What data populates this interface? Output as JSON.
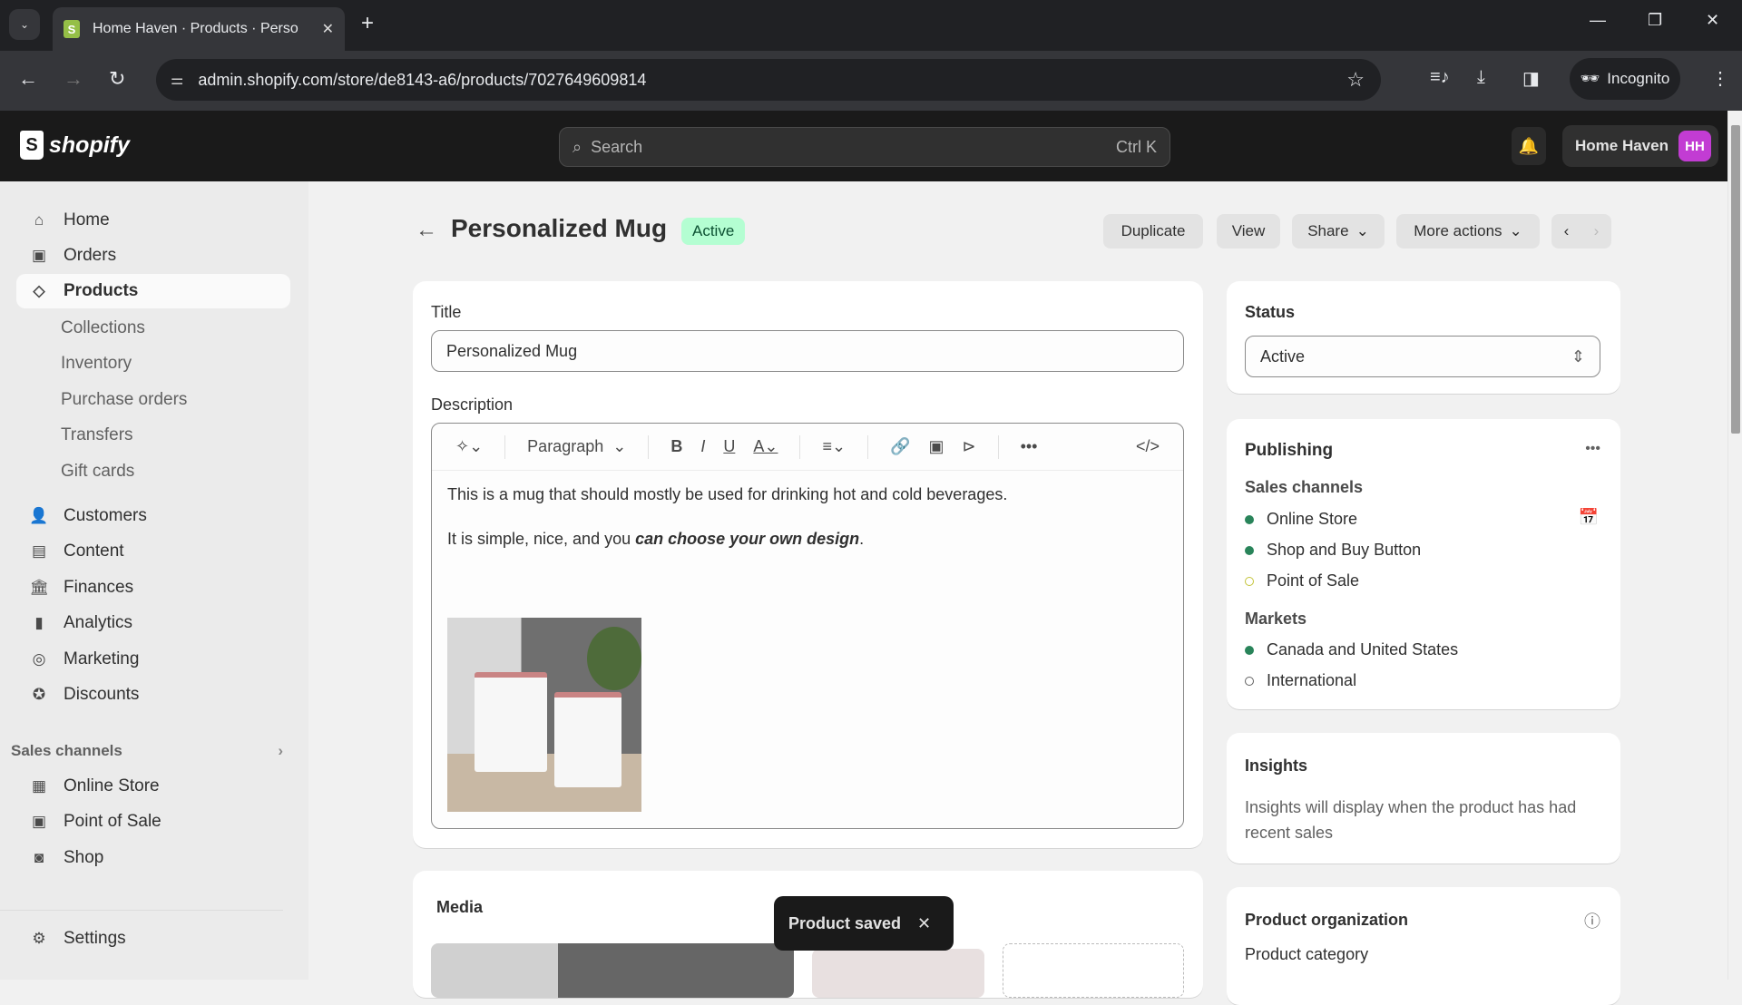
{
  "browser": {
    "tab_title": "Home Haven · Products · Perso",
    "url": "admin.shopify.com/store/de8143-a6/products/7027649609814",
    "incognito_label": "Incognito"
  },
  "header": {
    "logo_text": "shopify",
    "search_placeholder": "Search",
    "search_shortcut": "Ctrl K",
    "store_name": "Home Haven",
    "avatar_initials": "HH"
  },
  "sidebar": {
    "items": [
      {
        "label": "Home",
        "icon": "home-icon"
      },
      {
        "label": "Orders",
        "icon": "inbox-icon"
      },
      {
        "label": "Products",
        "icon": "tag-icon"
      }
    ],
    "product_subitems": [
      "Collections",
      "Inventory",
      "Purchase orders",
      "Transfers",
      "Gift cards"
    ],
    "items2": [
      {
        "label": "Customers",
        "icon": "person-icon"
      },
      {
        "label": "Content",
        "icon": "content-icon"
      },
      {
        "label": "Finances",
        "icon": "bank-icon"
      },
      {
        "label": "Analytics",
        "icon": "bar-chart-icon"
      },
      {
        "label": "Marketing",
        "icon": "target-icon"
      },
      {
        "label": "Discounts",
        "icon": "discount-icon"
      }
    ],
    "sales_channels_label": "Sales channels",
    "channels": [
      {
        "label": "Online Store",
        "icon": "store-icon"
      },
      {
        "label": "Point of Sale",
        "icon": "pos-icon"
      },
      {
        "label": "Shop",
        "icon": "shop-icon"
      }
    ],
    "settings_label": "Settings"
  },
  "page": {
    "title": "Personalized Mug",
    "status_badge": "Active",
    "actions": {
      "duplicate": "Duplicate",
      "view": "View",
      "share": "Share",
      "more": "More actions"
    }
  },
  "product_form": {
    "title_label": "Title",
    "title_value": "Personalized Mug",
    "description_label": "Description",
    "paragraph_style": "Paragraph",
    "description_line1": "This is a mug that should mostly be used for drinking hot and cold beverages.",
    "description_line2_plain": "It is simple, nice, and you ",
    "description_line2_emph": "can choose your own design",
    "description_line2_end": ".",
    "media_label": "Media"
  },
  "status_card": {
    "label": "Status",
    "value": "Active"
  },
  "publishing": {
    "title": "Publishing",
    "sales_channels_label": "Sales channels",
    "channels": [
      {
        "name": "Online Store",
        "state": "published"
      },
      {
        "name": "Shop and Buy Button",
        "state": "published"
      },
      {
        "name": "Point of Sale",
        "state": "unpublished"
      }
    ],
    "markets_label": "Markets",
    "markets": [
      {
        "name": "Canada and United States",
        "state": "published"
      },
      {
        "name": "International",
        "state": "unpublished"
      }
    ]
  },
  "insights": {
    "title": "Insights",
    "text": "Insights will display when the product has had recent sales"
  },
  "organization": {
    "title": "Product organization",
    "category_label": "Product category"
  },
  "toast": {
    "message": "Product saved"
  },
  "colors": {
    "accent_active": "#b4fed2",
    "published_dot": "#29845a",
    "pos_dot": "#c4c43a",
    "avatar": "#c23cd3"
  }
}
